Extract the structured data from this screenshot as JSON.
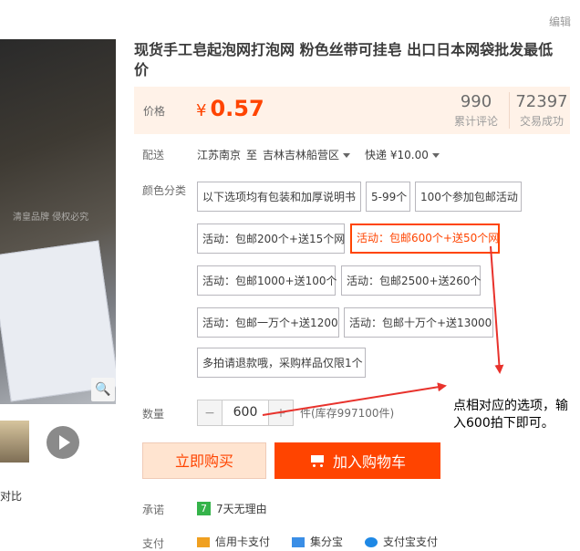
{
  "top": {
    "edit_label": "编辑"
  },
  "product": {
    "title": "现货手工皂起泡网打泡网 粉色丝带可挂皂 出口日本网袋批发最低价"
  },
  "gallery": {
    "watermark_text": "清皇品牌 侵权必究",
    "compare_label": "对比"
  },
  "price": {
    "label": "价格",
    "currency": "¥",
    "value": "0.57",
    "reviews_count": "990",
    "reviews_label": "累计评论",
    "sales_count": "72397",
    "sales_label": "交易成功"
  },
  "shipping": {
    "label": "配送",
    "from": "江苏南京",
    "to_label": "至",
    "to": "吉林吉林船营区",
    "method": "快递",
    "fee": "¥10.00"
  },
  "options": {
    "label": "颜色分类",
    "items": [
      "以下选项均有包装和加厚说明书",
      "5-99个",
      "100个参加包邮活动",
      "活动：包邮200个+送15个网",
      "活动：包邮600个+送50个网",
      "活动：包邮1000+送100个",
      "活动：包邮2500+送260个",
      "活动：包邮一万个+送1200",
      "活动：包邮十万个+送13000",
      "多拍请退款哦，采购样品仅限1个"
    ],
    "selected_index": 4
  },
  "quantity": {
    "label": "数量",
    "value": "600",
    "minus": "−",
    "plus": "+",
    "stock": "件(库存997100件)"
  },
  "actions": {
    "buy_now": "立即购买",
    "add_to_cart": "加入购物车"
  },
  "promise": {
    "label": "承诺",
    "badge": "7",
    "text": "7天无理由"
  },
  "payment": {
    "label": "支付",
    "methods": [
      "信用卡支付",
      "集分宝",
      "支付宝支付"
    ]
  },
  "annotation": {
    "text": "点相对应的选项，输入600拍下即可。",
    "color": "#e8322c"
  },
  "colors": {
    "accent": "#ff4400",
    "price_bg": "#fff2e8"
  }
}
